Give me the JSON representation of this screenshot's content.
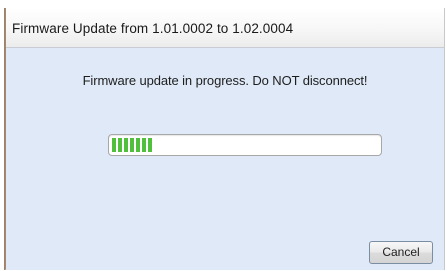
{
  "window": {
    "title": "Firmware Update from 1.01.0002 to 1.02.0004"
  },
  "content": {
    "status_message": "Firmware update in progress. Do NOT disconnect!",
    "progress": {
      "fraction": 0.15,
      "fill_color": "#4fbf3c"
    }
  },
  "buttons": {
    "cancel_label": "Cancel"
  },
  "colors": {
    "dialog_background": "#dfe9f7",
    "progress_fill": "#4fbf3c"
  }
}
